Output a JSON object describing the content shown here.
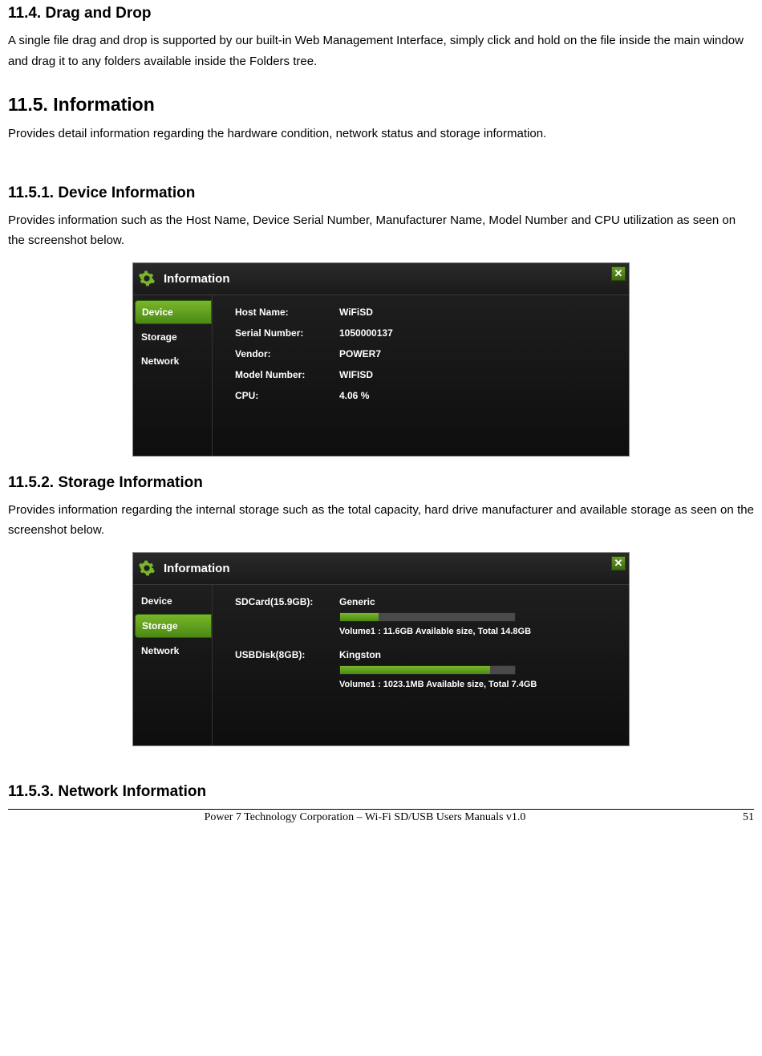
{
  "sections": {
    "s11_4": {
      "heading": "11.4. Drag and Drop",
      "text": "A single file drag and drop is supported by our built-in Web Management Interface, simply click and hold on the file inside the main window and drag it to any folders available inside the Folders tree."
    },
    "s11_5": {
      "heading": "11.5. Information",
      "text": "Provides detail information regarding the hardware condition, network status and storage information."
    },
    "s11_5_1": {
      "heading": "11.5.1. Device Information",
      "text": "Provides information such as the Host Name, Device Serial Number, Manufacturer Name, Model Number and CPU utilization as seen on the screenshot below."
    },
    "s11_5_2": {
      "heading": "11.5.2. Storage Information",
      "text": "Provides information regarding the internal storage such as the total capacity, hard drive manufacturer and available storage as seen on the screenshot below."
    },
    "s11_5_3": {
      "heading": "11.5.3. Network Information"
    }
  },
  "dialog_common": {
    "title": "Information",
    "close": "✕",
    "tabs": {
      "device": "Device",
      "storage": "Storage",
      "network": "Network"
    }
  },
  "device_info": {
    "rows": [
      {
        "label": "Host Name:",
        "value": "WiFiSD"
      },
      {
        "label": "Serial Number:",
        "value": "1050000137"
      },
      {
        "label": "Vendor:",
        "value": "POWER7"
      },
      {
        "label": "Model Number:",
        "value": "WIFISD"
      },
      {
        "label": "CPU:",
        "value": "4.06 %"
      }
    ]
  },
  "storage_info": {
    "items": [
      {
        "label": "SDCard(15.9GB):",
        "brand": "Generic",
        "fill_pct": 22,
        "caption": "Volume1 : 11.6GB Available size, Total 14.8GB"
      },
      {
        "label": "USBDisk(8GB):",
        "brand": "Kingston",
        "fill_pct": 86,
        "caption": "Volume1 : 1023.1MB Available size, Total 7.4GB"
      }
    ]
  },
  "footer": {
    "text": "Power 7 Technology Corporation – Wi-Fi SD/USB Users Manuals v1.0",
    "page": "51"
  }
}
